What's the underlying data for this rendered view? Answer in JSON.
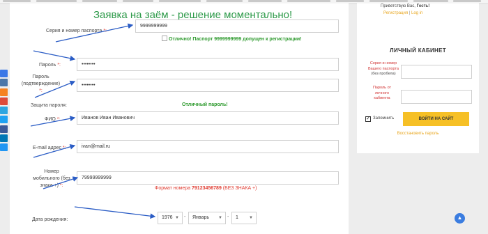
{
  "form": {
    "title": "Заявка на заём - решение моментально!",
    "passport_label": "Серия и номер паспорта",
    "passport_value": "9999999999",
    "passport_ok": "Отлично! Паспорт 9999999999 допущен к регистрации!",
    "password_label": "Пароль",
    "password_value": "••••••••",
    "password_confirm_label_1": "Пароль",
    "password_confirm_label_2": "(подтверждение)",
    "password_confirm_value": "••••••••",
    "protection_label": "Защита пароля:",
    "protection_value": "Отличный пароль!",
    "fio_label": "ФИО",
    "fio_value": "Иванов Иван Иванович",
    "email_label": "E-mail адрес",
    "email_value": "ivan@mail.ru",
    "phone_label_1": "Номер",
    "phone_label_2": "мобильного (без",
    "phone_label_3": "знака +)",
    "phone_value": "79999999999",
    "phone_hint_prefix": "Формат номера",
    "phone_hint_number": "79123456789",
    "phone_hint_suffix": "(БЕЗ ЗНАКА +)",
    "required_mark": "*:",
    "birth_label": "Дата рождения:",
    "birth_year": "1976",
    "birth_month": "Январь",
    "birth_day": "1",
    "birth_sep": "-"
  },
  "sidebar": {
    "greeting_prefix": "Приветствую Вас,",
    "greeting_name": "Гость!",
    "register_link": "Регистрация",
    "links_sep": "|",
    "login_link": "Log in",
    "cabinet_title": "ЛИЧНЫЙ КАБИНЕТ",
    "passport_field_label_1": "Серия и номер",
    "passport_field_label_2": "Вашего паспорта",
    "passport_field_note": "(без пробела)",
    "password_field_label_1": "Пароль от",
    "password_field_label_2": "личного",
    "password_field_label_3": "кабинета",
    "remember_label": "Запомнить",
    "login_button": "ВОЙТИ НА САЙТ",
    "restore_link": "Восстановить пароль"
  },
  "social": {
    "icons": [
      "odnoklassniki-icon",
      "vk-icon",
      "mail-ru-icon",
      "google-icon",
      "telegram-icon",
      "twitter-icon",
      "facebook-icon",
      "linkedin-icon",
      "share-icon"
    ],
    "colors": [
      "#3b78e7",
      "#4a76a8",
      "#f58220",
      "#dd4b39",
      "#2ca5e0",
      "#1da1f2",
      "#3b5998",
      "#0077b5",
      "#2196f3"
    ]
  },
  "scroll_top_glyph": "▲",
  "colors": {
    "title_green": "#2e9a4a",
    "ok_green": "#2e9a2e",
    "required_red": "#e03c31",
    "accent_orange": "#e8a51c",
    "button_yellow": "#f6c026",
    "arrow_blue": "#2a5cc5"
  }
}
